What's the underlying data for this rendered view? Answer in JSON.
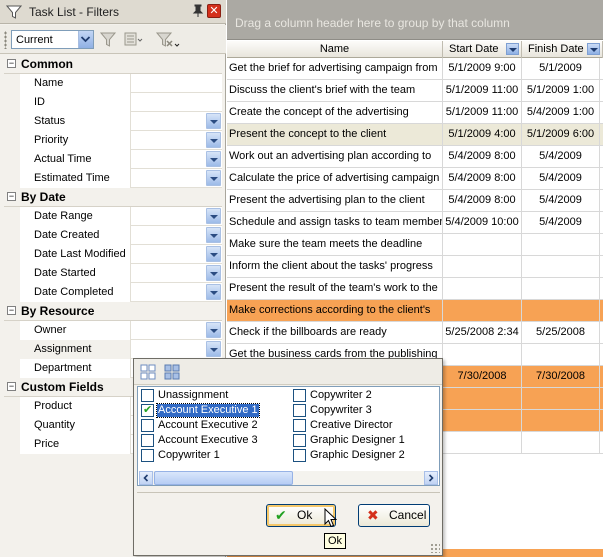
{
  "filter_panel": {
    "title": "Task List - Filters",
    "view_combo_value": "Current",
    "categories": [
      {
        "label": "Common",
        "toggle": "−",
        "rows": [
          {
            "name": "Name",
            "has_combo": false
          },
          {
            "name": "ID",
            "has_combo": false
          },
          {
            "name": "Status",
            "has_combo": true
          },
          {
            "name": "Priority",
            "has_combo": true
          },
          {
            "name": "Actual Time",
            "has_combo": true
          },
          {
            "name": "Estimated Time",
            "has_combo": true
          }
        ]
      },
      {
        "label": "By Date",
        "toggle": "−",
        "rows": [
          {
            "name": "Date Range",
            "has_combo": true
          },
          {
            "name": "Date Created",
            "has_combo": true
          },
          {
            "name": "Date Last Modified",
            "has_combo": true
          },
          {
            "name": "Date Started",
            "has_combo": true
          },
          {
            "name": "Date Completed",
            "has_combo": true
          }
        ]
      },
      {
        "label": "By Resource",
        "toggle": "−",
        "rows": [
          {
            "name": "Owner",
            "has_combo": true
          },
          {
            "name": "Assignment",
            "has_combo": true,
            "selected": true
          },
          {
            "name": "Department",
            "has_combo": false
          }
        ]
      },
      {
        "label": "Custom Fields",
        "toggle": "−",
        "rows": [
          {
            "name": "Product",
            "has_combo": false
          },
          {
            "name": "Quantity",
            "has_combo": false
          },
          {
            "name": "Price",
            "has_combo": false
          }
        ]
      }
    ]
  },
  "task_grid": {
    "group_hint": "Drag a column header here to group by that column",
    "columns": {
      "name": "Name",
      "start": "Start Date",
      "finish": "Finish Date"
    },
    "rows": [
      {
        "name": "Get the brief for advertising campaign from",
        "start": "5/1/2009 9:00",
        "finish": "5/1/2009",
        "style": "white"
      },
      {
        "name": "Discuss the client's brief with the team",
        "start": "5/1/2009 11:00",
        "finish": "5/1/2009 1:00",
        "style": "white"
      },
      {
        "name": "Create the concept of the advertising",
        "start": "5/1/2009 11:00",
        "finish": "5/4/2009 1:00",
        "style": "white"
      },
      {
        "name": "Present the concept to the client",
        "start": "5/1/2009 4:00",
        "finish": "5/1/2009 6:00",
        "style": "beige"
      },
      {
        "name": "Work out an advertising plan according to",
        "start": "5/4/2009 8:00",
        "finish": "5/4/2009",
        "style": "white"
      },
      {
        "name": "Calculate the price of advertising campaign",
        "start": "5/4/2009 8:00",
        "finish": "5/4/2009",
        "style": "white"
      },
      {
        "name": "Present the advertising plan to the client",
        "start": "5/4/2009 8:00",
        "finish": "5/4/2009",
        "style": "white"
      },
      {
        "name": "Schedule and assign tasks to team members",
        "start": "5/4/2009 10:00",
        "finish": "5/4/2009",
        "style": "white"
      },
      {
        "name": "Make sure the team meets the deadline",
        "start": "",
        "finish": "",
        "style": "white"
      },
      {
        "name": "Inform the client about the tasks' progress",
        "start": "",
        "finish": "",
        "style": "white"
      },
      {
        "name": "Present the result of the team's work to the",
        "start": "",
        "finish": "",
        "style": "white"
      },
      {
        "name": "Make corrections according to the client's",
        "start": "",
        "finish": "",
        "style": "orange"
      },
      {
        "name": "Check if the billboards are ready",
        "start": "5/25/2008 2:34",
        "finish": "5/25/2008",
        "style": "white"
      },
      {
        "name": "Get the business cards from the publishing",
        "start": "",
        "finish": "",
        "style": "white"
      },
      {
        "name": "",
        "start": "7/30/2008",
        "finish": "7/30/2008",
        "style": "orange"
      },
      {
        "name": "",
        "start": "",
        "finish": "",
        "style": "orange"
      },
      {
        "name": "",
        "start": "",
        "finish": "",
        "style": "orange"
      },
      {
        "name": "",
        "start": "",
        "finish": "",
        "style": "white"
      }
    ]
  },
  "popup": {
    "items_left": [
      {
        "label": "Unassignment",
        "checked": false,
        "selected": false
      },
      {
        "label": "Account Executive 1",
        "checked": true,
        "selected": true
      },
      {
        "label": "Account Executive 2",
        "checked": false,
        "selected": false
      },
      {
        "label": "Account Executive 3",
        "checked": false,
        "selected": false
      },
      {
        "label": "Copywriter 1",
        "checked": false,
        "selected": false
      }
    ],
    "items_right": [
      {
        "label": "Copywriter 2",
        "checked": false,
        "selected": false
      },
      {
        "label": "Copywriter 3",
        "checked": false,
        "selected": false
      },
      {
        "label": "Creative Director",
        "checked": false,
        "selected": false
      },
      {
        "label": "Graphic Designer 1",
        "checked": false,
        "selected": false
      },
      {
        "label": "Graphic Designer 2",
        "checked": false,
        "selected": false
      }
    ],
    "ok_label": "Ok",
    "cancel_label": "Cancel",
    "ok_icon": "✔",
    "cancel_icon": "✖",
    "tooltip": "Ok"
  },
  "colors": {
    "row_highlight_orange": "#f7a254",
    "row_highlight_beige": "#ece9d8",
    "ok_icon_green": "#21a121",
    "cancel_icon_red": "#d4301b",
    "selection_blue": "#316ac5"
  }
}
